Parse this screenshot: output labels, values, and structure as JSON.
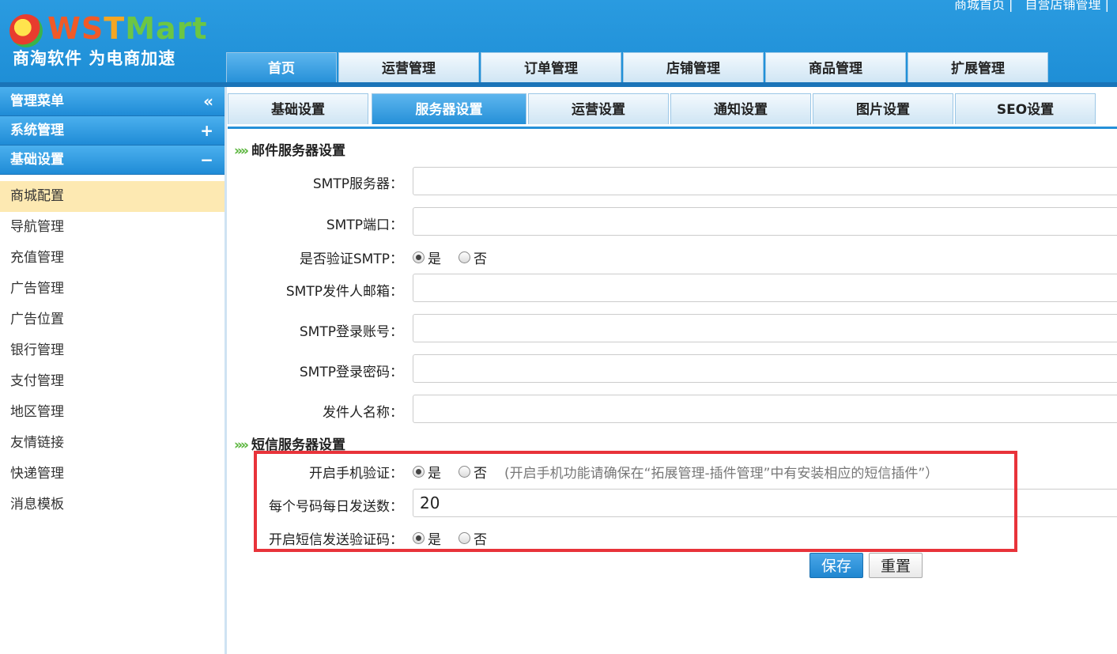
{
  "brand": {
    "logo_ws": "WS",
    "logo_t": "T",
    "logo_mart": "Mart",
    "slogan": "商淘软件 为电商加速"
  },
  "top_links": [
    "商城首页 |",
    "自营店铺管理 |"
  ],
  "main_nav": [
    "首页",
    "运营管理",
    "订单管理",
    "店铺管理",
    "商品管理",
    "扩展管理"
  ],
  "sidebar": {
    "menu_title": "管理菜单",
    "menu_symbol": "«",
    "system": "系统管理",
    "system_symbol": "+",
    "basic": "基础设置",
    "basic_symbol": "−",
    "items": [
      "商城配置",
      "导航管理",
      "充值管理",
      "广告管理",
      "广告位置",
      "银行管理",
      "支付管理",
      "地区管理",
      "友情链接",
      "快递管理",
      "消息模板"
    ]
  },
  "sub_tabs": [
    "基础设置",
    "服务器设置",
    "运营设置",
    "通知设置",
    "图片设置",
    "SEO设置"
  ],
  "mail": {
    "title": "邮件服务器设置",
    "smtp_server_label": "SMTP服务器：",
    "smtp_server_value": "",
    "smtp_port_label": "SMTP端口：",
    "smtp_port_value": "",
    "verify_label": "是否验证SMTP：",
    "yes": "是",
    "no": "否",
    "sender_email_label": "SMTP发件人邮箱：",
    "sender_email_value": "",
    "login_account_label": "SMTP登录账号：",
    "login_account_value": "",
    "login_password_label": "SMTP登录密码：",
    "login_password_value": "",
    "sender_name_label": "发件人名称：",
    "sender_name_value": ""
  },
  "sms": {
    "title": "短信服务器设置",
    "phone_verify_label": "开启手机验证：",
    "hint": "(开启手机功能请确保在“拓展管理-插件管理”中有安装相应的短信插件”）",
    "daily_limit_label": "每个号码每日发送数：",
    "daily_limit_value": "20",
    "sms_code_label": "开启短信发送验证码："
  },
  "buttons": {
    "save": "保存",
    "reset": "重置"
  },
  "colors": {
    "header_blue": "#1e8ed6",
    "highlight": "#e8333a",
    "active_side": "#fde9b2",
    "accent_green": "#5ab53c"
  }
}
